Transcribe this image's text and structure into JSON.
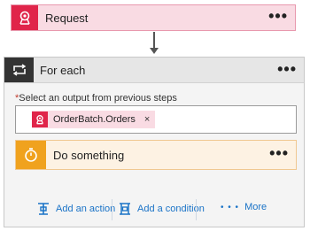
{
  "request": {
    "title": "Request",
    "menu": "•••",
    "icon": "request-icon"
  },
  "foreach": {
    "title": "For each",
    "menu": "•••",
    "icon": "loop-icon"
  },
  "select": {
    "required_marker": "*",
    "label": "Select an output from previous steps",
    "token": {
      "label": "OrderBatch.Orders",
      "remove": "×",
      "icon": "request-icon"
    }
  },
  "action_card": {
    "title": "Do something",
    "menu": "•••",
    "icon": "timer-icon"
  },
  "footer": {
    "add_action": "Add an action",
    "add_condition": "Add a condition",
    "more": "More",
    "more_glyph": "• • •"
  },
  "colors": {
    "request_accent": "#e0254a",
    "loop_accent": "#333333",
    "action_accent": "#f0a21e",
    "link": "#1a73c7"
  }
}
